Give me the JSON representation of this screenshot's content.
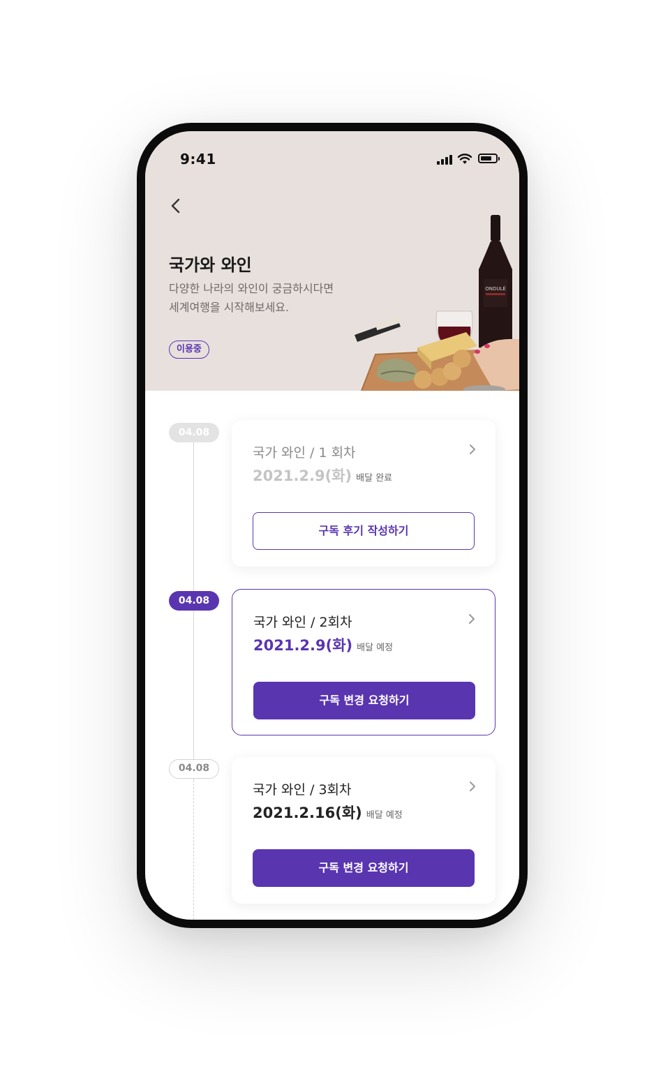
{
  "status_bar": {
    "time": "9:41"
  },
  "header": {
    "title": "국가와 와인",
    "description_line1": "다양한 나라의 와인이 궁금하시다면",
    "description_line2": "세계여행을 시작해보세요.",
    "badge": "이용중"
  },
  "timeline": [
    {
      "date_pill": "04.08",
      "state": "done",
      "title": "국가 와인 / 1 회차",
      "date": "2021.2.9(화)",
      "status": "배달 완료",
      "button": "구독 후기 작성하기"
    },
    {
      "date_pill": "04.08",
      "state": "active",
      "title": "국가 와인 / 2회차",
      "date": "2021.2.9(화)",
      "status": "배달 예정",
      "button": "구독 변경 요청하기"
    },
    {
      "date_pill": "04.08",
      "state": "future",
      "title": "국가 와인 / 3회차",
      "date": "2021.2.16(화)",
      "status": "배달 예정",
      "button": "구독 변경 요청하기"
    }
  ],
  "colors": {
    "accent": "#5a35b0",
    "hero_background": "#e8e0dd",
    "pill_done": "#e3e3e3",
    "text_muted": "#8a8a8a"
  },
  "icons": [
    "back-chevron-icon",
    "chevron-right-icon",
    "signal-icon",
    "wifi-icon",
    "battery-icon"
  ]
}
